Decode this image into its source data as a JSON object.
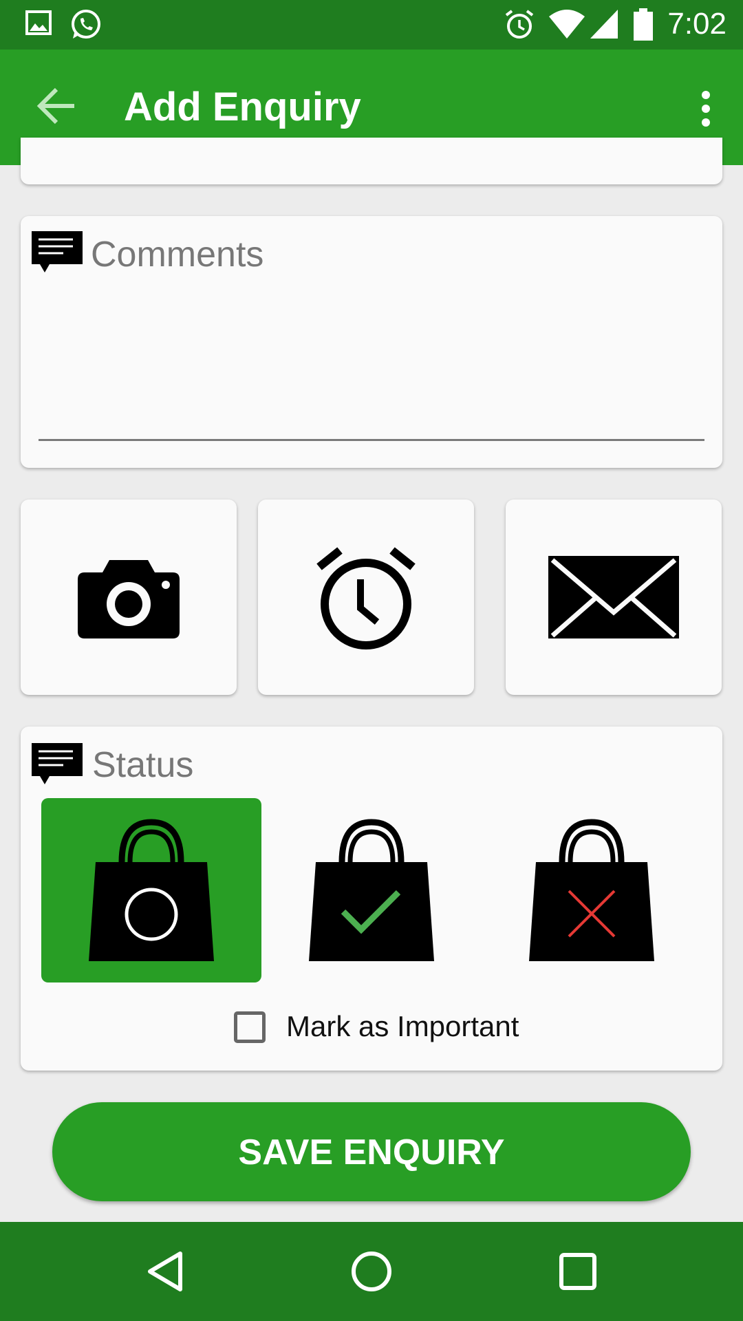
{
  "status_bar": {
    "time": "7:02",
    "icons": [
      "image-icon",
      "whatsapp-icon",
      "alarm-icon",
      "wifi-icon",
      "signal-icon",
      "battery-icon"
    ]
  },
  "app_bar": {
    "title": "Add Enquiry",
    "back_icon": "arrow-back-icon",
    "menu_icon": "more-vert-icon"
  },
  "comments": {
    "placeholder": "Comments",
    "value": "",
    "icon": "comment-icon"
  },
  "actions": [
    {
      "icon": "camera-icon"
    },
    {
      "icon": "alarm-clock-icon"
    },
    {
      "icon": "envelope-icon"
    }
  ],
  "status": {
    "label": "Status",
    "icon": "comment-icon",
    "options": [
      {
        "icon": "shopping-bag-open-icon",
        "selected": true
      },
      {
        "icon": "shopping-bag-check-icon",
        "selected": false
      },
      {
        "icon": "shopping-bag-cross-icon",
        "selected": false
      }
    ],
    "mark_important_label": "Mark as Important",
    "mark_important_checked": false
  },
  "save_button": {
    "label": "SAVE ENQUIRY"
  },
  "nav_bar": {
    "icons": [
      "nav-back-icon",
      "nav-home-icon",
      "nav-recents-icon"
    ]
  },
  "colors": {
    "app_bar": "#289e25",
    "status_bar": "#1f7d1f",
    "check": "#4caf50",
    "cross": "#e53935"
  }
}
